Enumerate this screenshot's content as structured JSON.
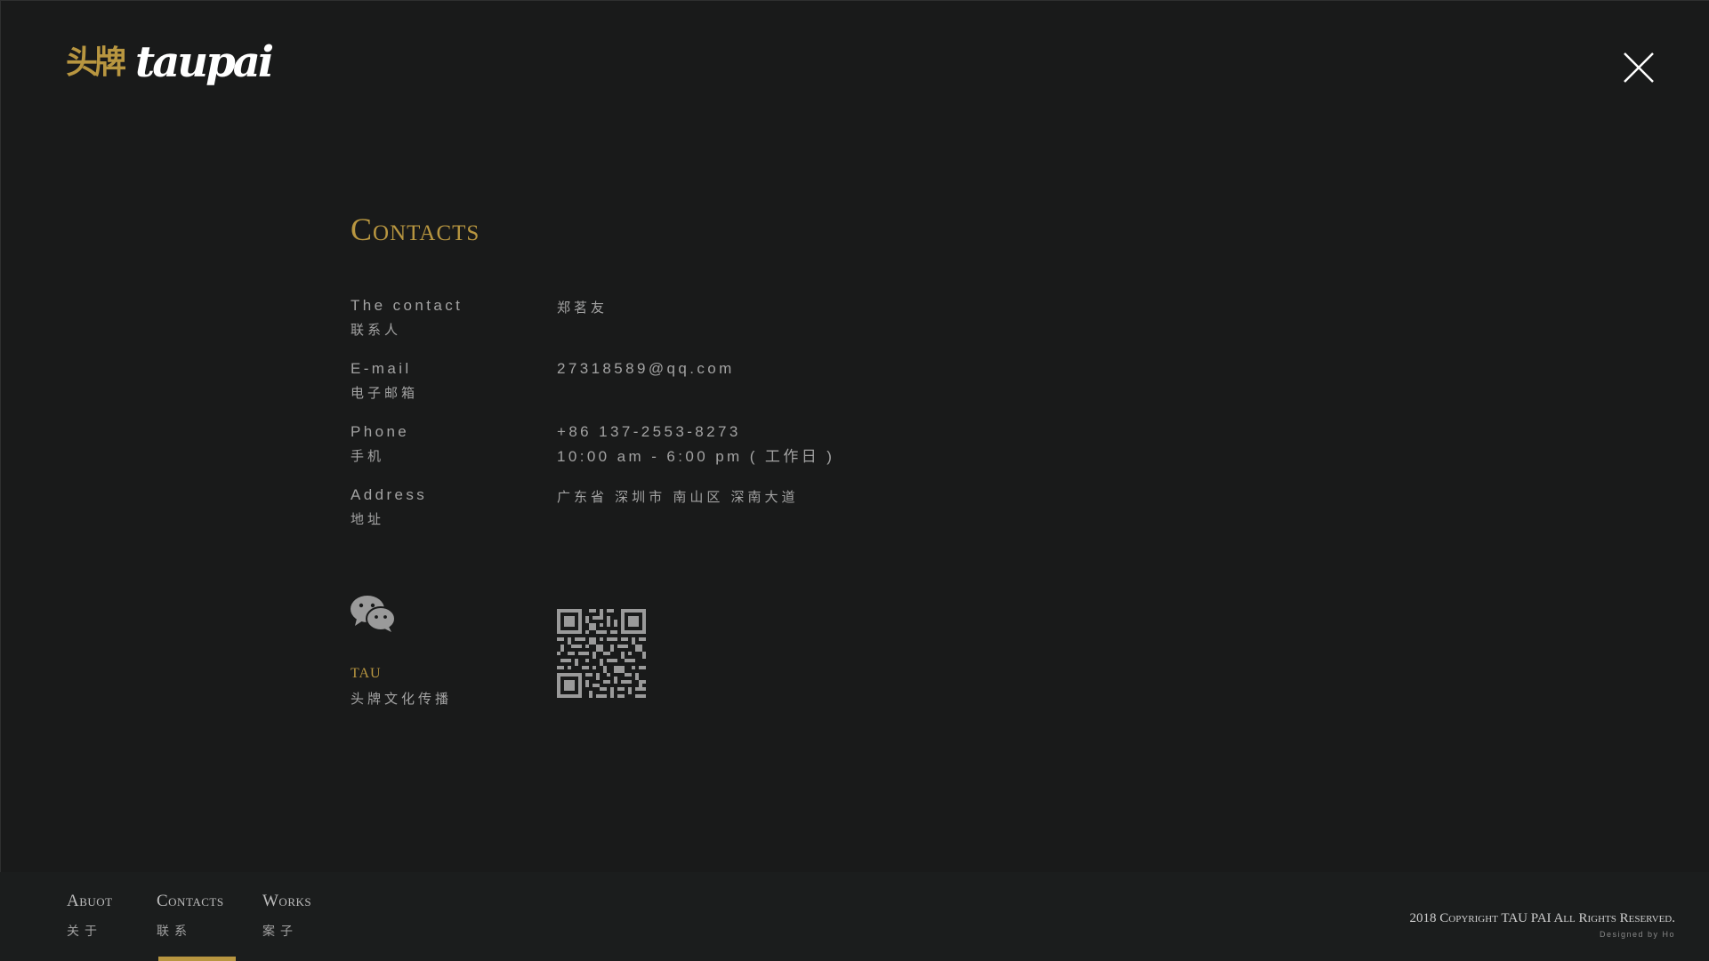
{
  "header": {
    "logo_cn": "头牌",
    "logo_en": "taupai",
    "close_label": "close"
  },
  "contacts": {
    "title": "Contacts",
    "rows": [
      {
        "label_en": "The contact",
        "label_cn": "联系人",
        "value": "郑茗友"
      },
      {
        "label_en": "E-mail",
        "label_cn": "电子邮箱",
        "value": "27318589@qq.com"
      },
      {
        "label_en": "Phone",
        "label_cn": "手机",
        "value": "+86 137-2553-8273",
        "value2": "10:00 am - 6:00 pm ( 工作日 )"
      },
      {
        "label_en": "Address",
        "label_cn": "地址",
        "value": "广东省 深圳市 南山区 深南大道"
      }
    ],
    "wechat": {
      "name": "TAU",
      "name_cn": "头牌文化传播",
      "icon": "wechat-icon"
    }
  },
  "footer": {
    "nav": [
      {
        "en": "Abuot",
        "cn": "关于"
      },
      {
        "en": "Contacts",
        "cn": "联系",
        "active": true
      },
      {
        "en": "Works",
        "cn": "案子"
      }
    ],
    "copyright": "2018 Copyright TAU PAI All Rights Reserved.",
    "designed_by": "Designed by Ho"
  },
  "colors": {
    "background": "#191a1a",
    "accent": "#b89640",
    "text": "#a3a3a3"
  }
}
